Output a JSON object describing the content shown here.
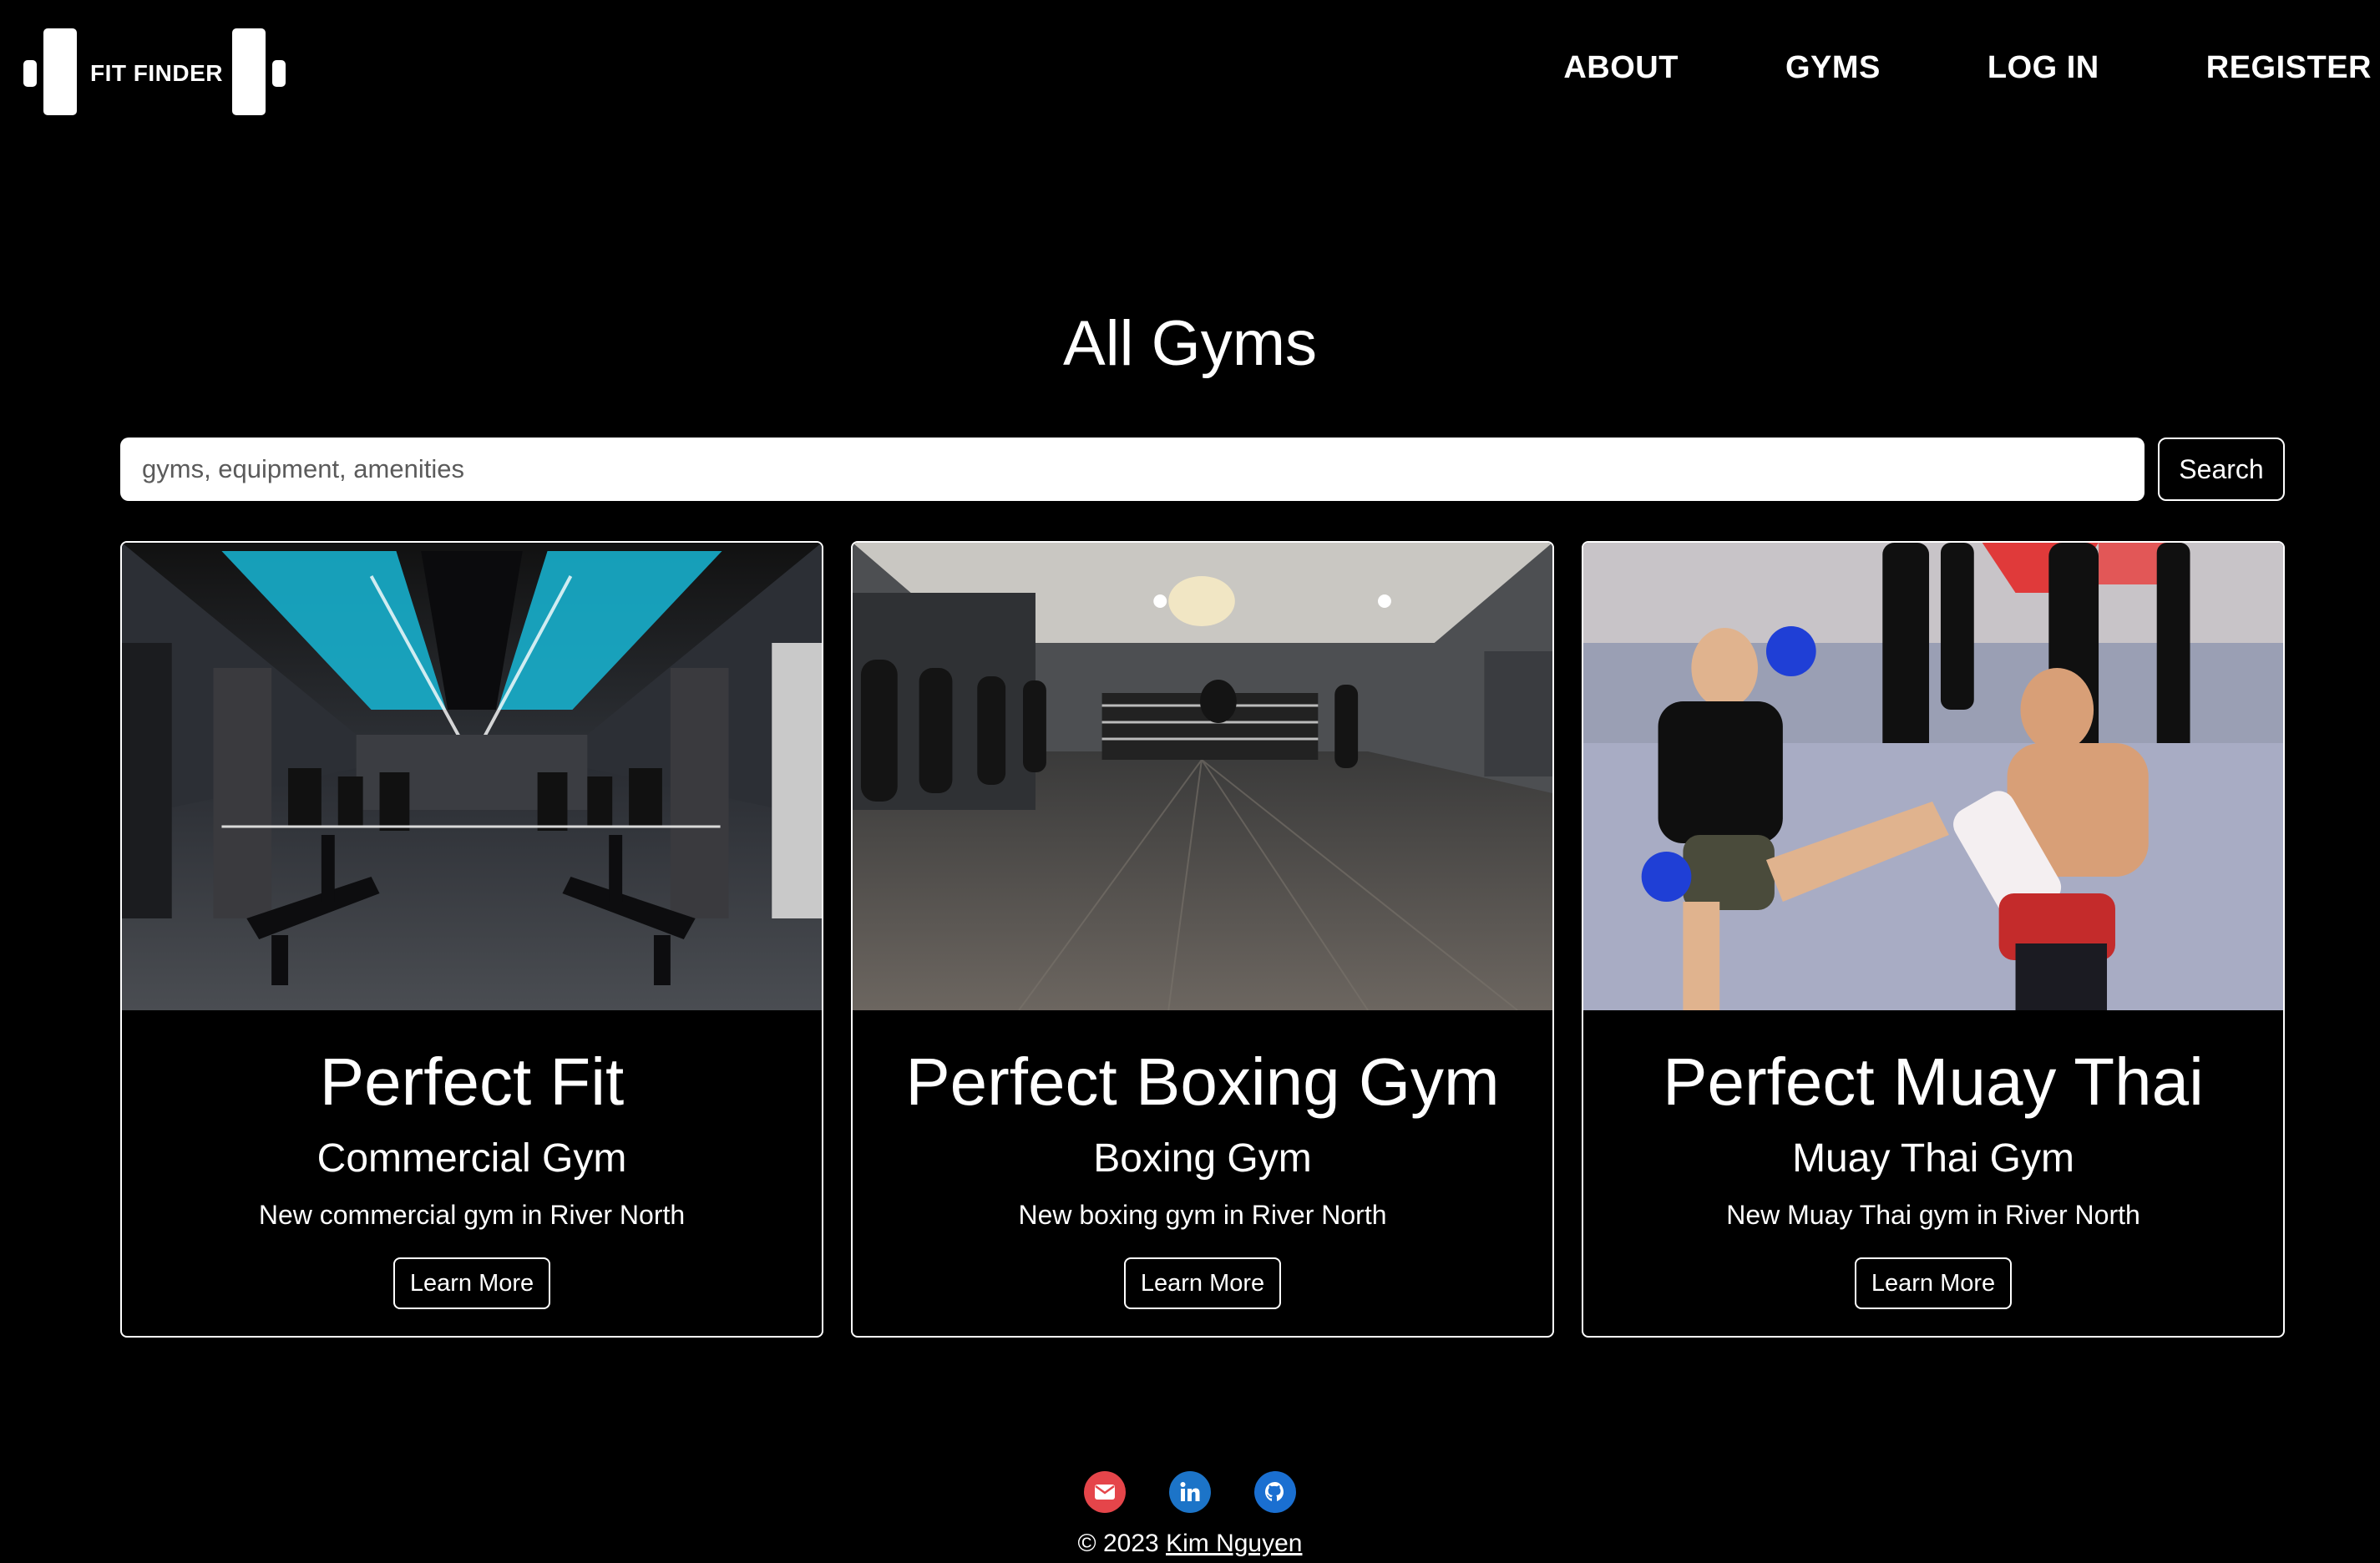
{
  "brand": {
    "name": "FIT FINDER"
  },
  "nav": {
    "items": [
      {
        "label": "ABOUT"
      },
      {
        "label": "GYMS"
      },
      {
        "label": "LOG IN"
      },
      {
        "label": "REGISTER"
      }
    ]
  },
  "page": {
    "title": "All Gyms"
  },
  "search": {
    "placeholder": "gyms, equipment, amenities",
    "value": "",
    "button_label": "Search"
  },
  "gyms": [
    {
      "name": "Perfect Fit",
      "type": "Commercial Gym",
      "description": "New commercial gym in River North",
      "button_label": "Learn More",
      "image": "gym-interior-photo"
    },
    {
      "name": "Perfect Boxing Gym",
      "type": "Boxing Gym",
      "description": "New boxing gym in River North",
      "button_label": "Learn More",
      "image": "boxing-gym-photo"
    },
    {
      "name": "Perfect Muay Thai",
      "type": "Muay Thai Gym",
      "description": "New Muay Thai gym in River North",
      "button_label": "Learn More",
      "image": "muay-thai-photo"
    }
  ],
  "footer": {
    "socials": [
      {
        "icon": "mail-icon",
        "color": "#e5454a"
      },
      {
        "icon": "linkedin-icon",
        "color": "#1c74c8"
      },
      {
        "icon": "github-icon",
        "color": "#1a6fd1"
      }
    ],
    "copyright_prefix": "© 2023",
    "author": "Kim Nguyen"
  }
}
